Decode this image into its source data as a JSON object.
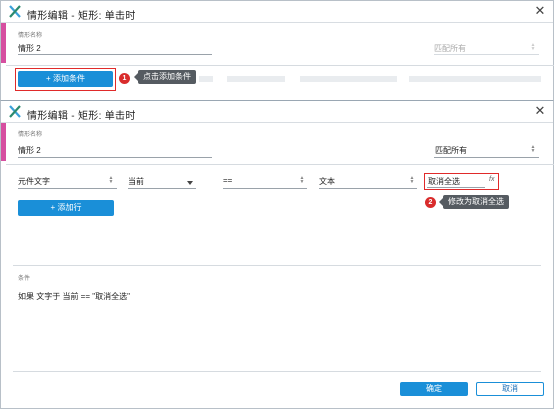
{
  "dialog1": {
    "title": "情形编辑  -  矩形: 单击时",
    "case_name_label": "情形名称",
    "case_name_value": "情形 2",
    "match_placeholder": "匹配所有",
    "add_condition_label": "+ 添加条件",
    "callout_1": {
      "number": "1",
      "text": "点击添加条件"
    }
  },
  "dialog2": {
    "title": "情形编辑  -  矩形: 单击时",
    "case_name_label": "情形名称",
    "case_name_value": "情形 2",
    "match_value": "匹配所有",
    "condition_row": {
      "field1": "元件文字",
      "field2": "当前",
      "operator": "==",
      "field4": "文本",
      "value": "取消全选",
      "fx_label": "fx"
    },
    "add_row_label": "+ 添加行",
    "callout_2": {
      "number": "2",
      "text": "修改为取消全选"
    },
    "conditions_label": "条件",
    "condition_summary": "如果 文字于 当前 == \"取消全选\"",
    "ok_label": "确定",
    "cancel_label": "取消"
  },
  "colors": {
    "accent_pink": "#d64fa0",
    "primary_blue": "#1a8fd8",
    "highlight_red": "#e02a2a",
    "tooltip_gray": "#555b61"
  },
  "icons": {
    "logo": "axure-x-logo-icon",
    "close": "close-icon",
    "spinner": "up-down-spinner-icon",
    "dropdown": "chevron-down-icon",
    "function": "fx-function-icon"
  }
}
